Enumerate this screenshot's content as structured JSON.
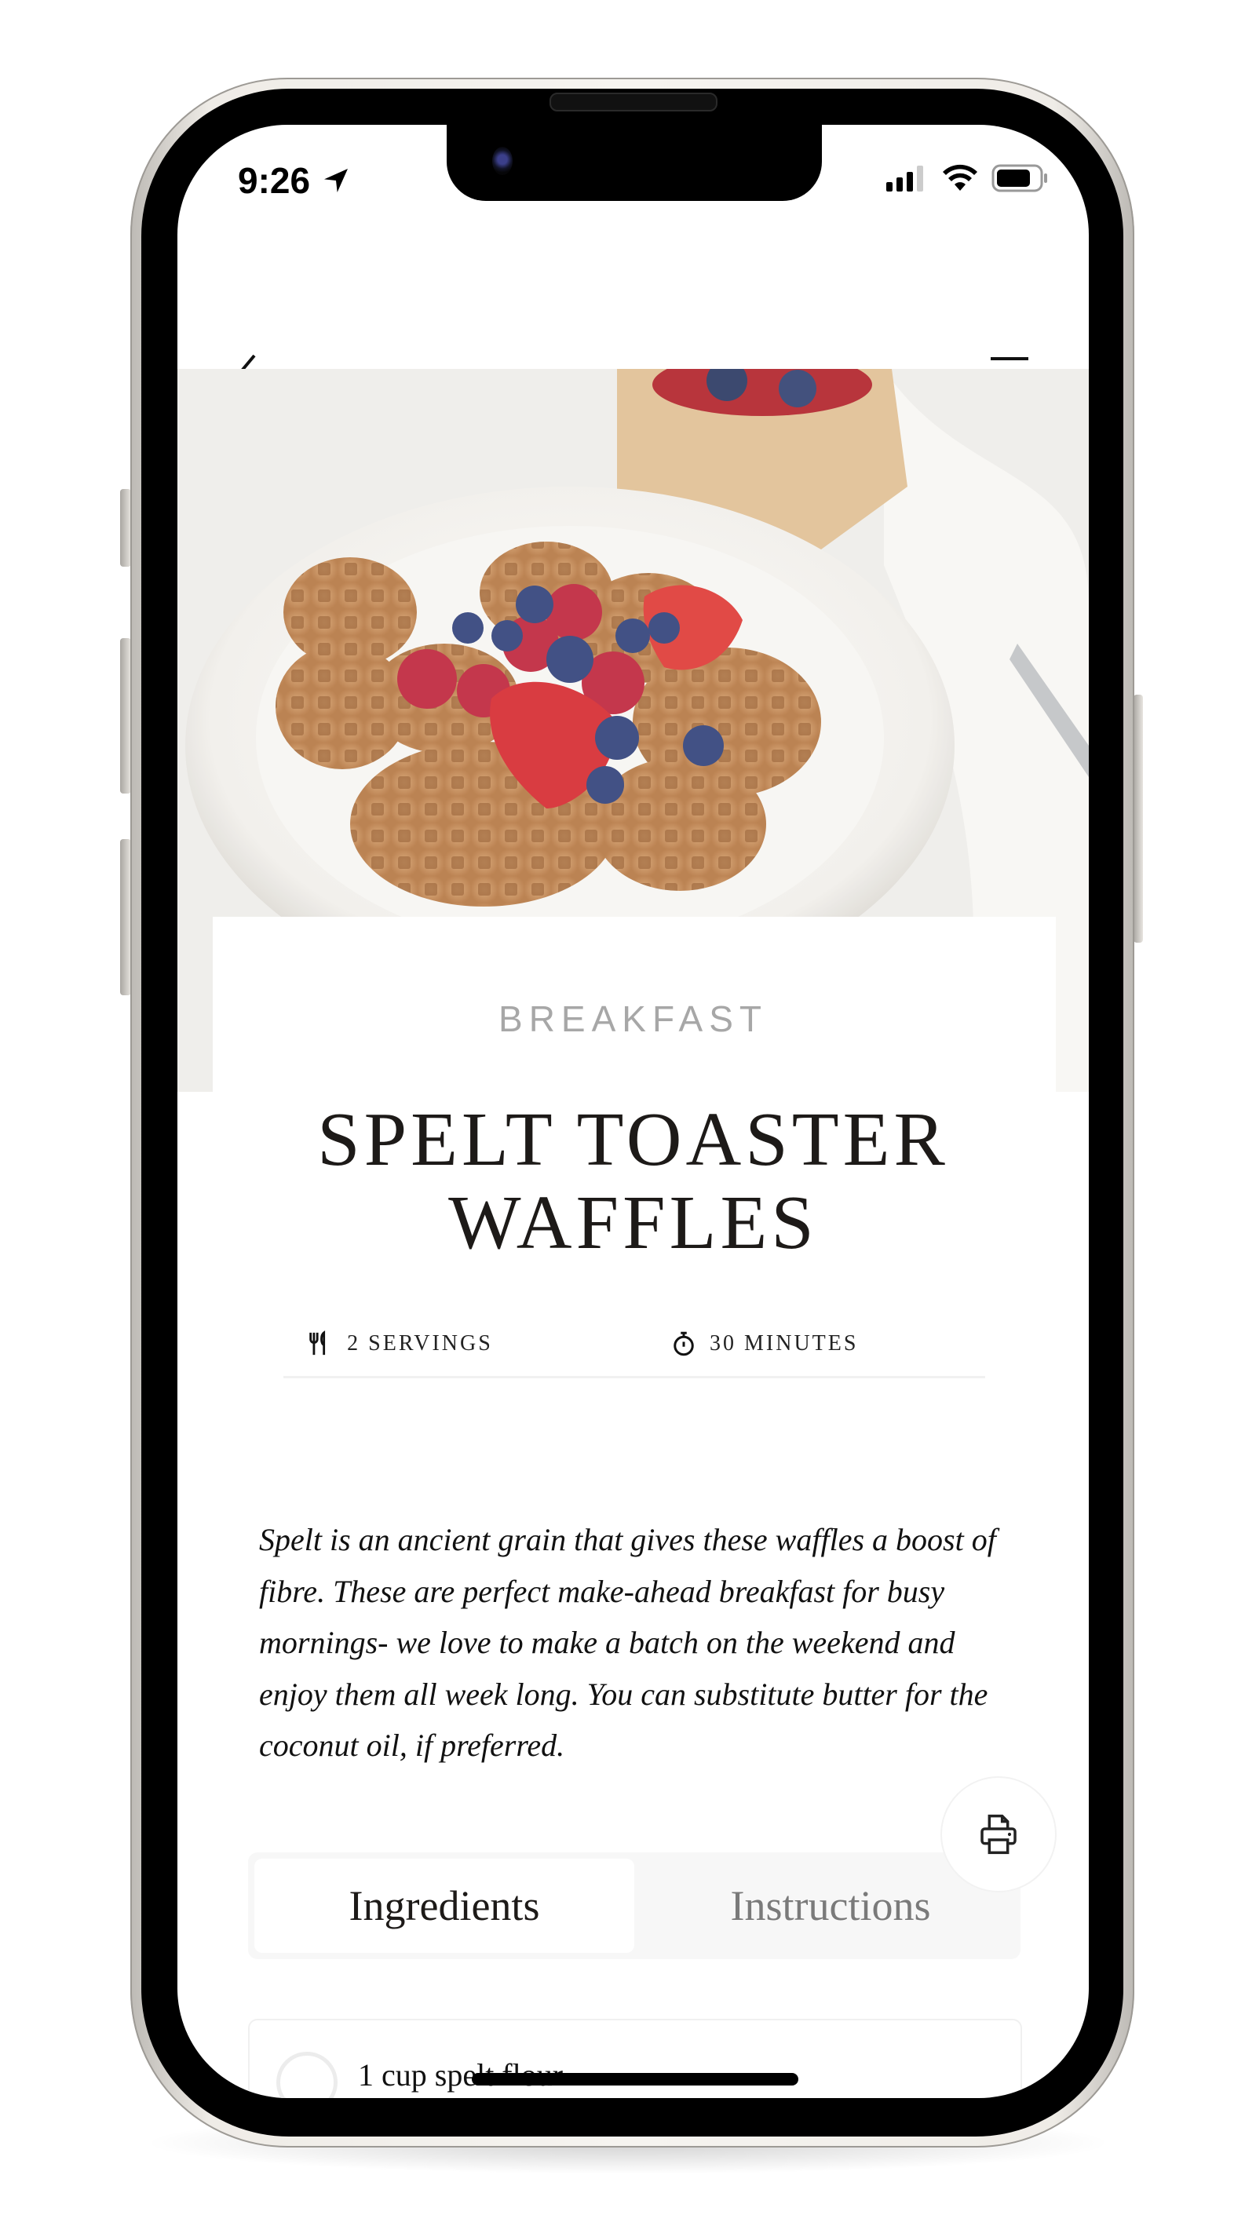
{
  "status_bar": {
    "time": "9:26",
    "icons": [
      "location-arrow-icon",
      "cellular-signal-icon",
      "wifi-icon",
      "battery-icon"
    ]
  },
  "nav": {
    "back_icon": "chevron-left-icon",
    "menu_icon": "hamburger-menu-icon"
  },
  "recipe": {
    "category": "BREAKFAST",
    "title_line1": "SPELT TOASTER",
    "title_line2": "WAFFLES",
    "servings": "2 SERVINGS",
    "time": "30 MINUTES",
    "description": "Spelt is an ancient grain that gives these waffles a boost of fibre. These are perfect make-ahead breakfast for busy mornings- we love to make a batch on the weekend and enjoy them all week long. You can substitute butter for the coconut oil, if preferred."
  },
  "tabs": [
    {
      "label": "Ingredients",
      "active": true
    },
    {
      "label": "Instructions",
      "active": false
    }
  ],
  "ingredients": [
    {
      "text": "1 cup spelt flour",
      "checked": false
    }
  ],
  "colors": {
    "text": "#1d1a18",
    "muted": "#a7a7a7",
    "tab_bg": "#f7f7f7"
  }
}
